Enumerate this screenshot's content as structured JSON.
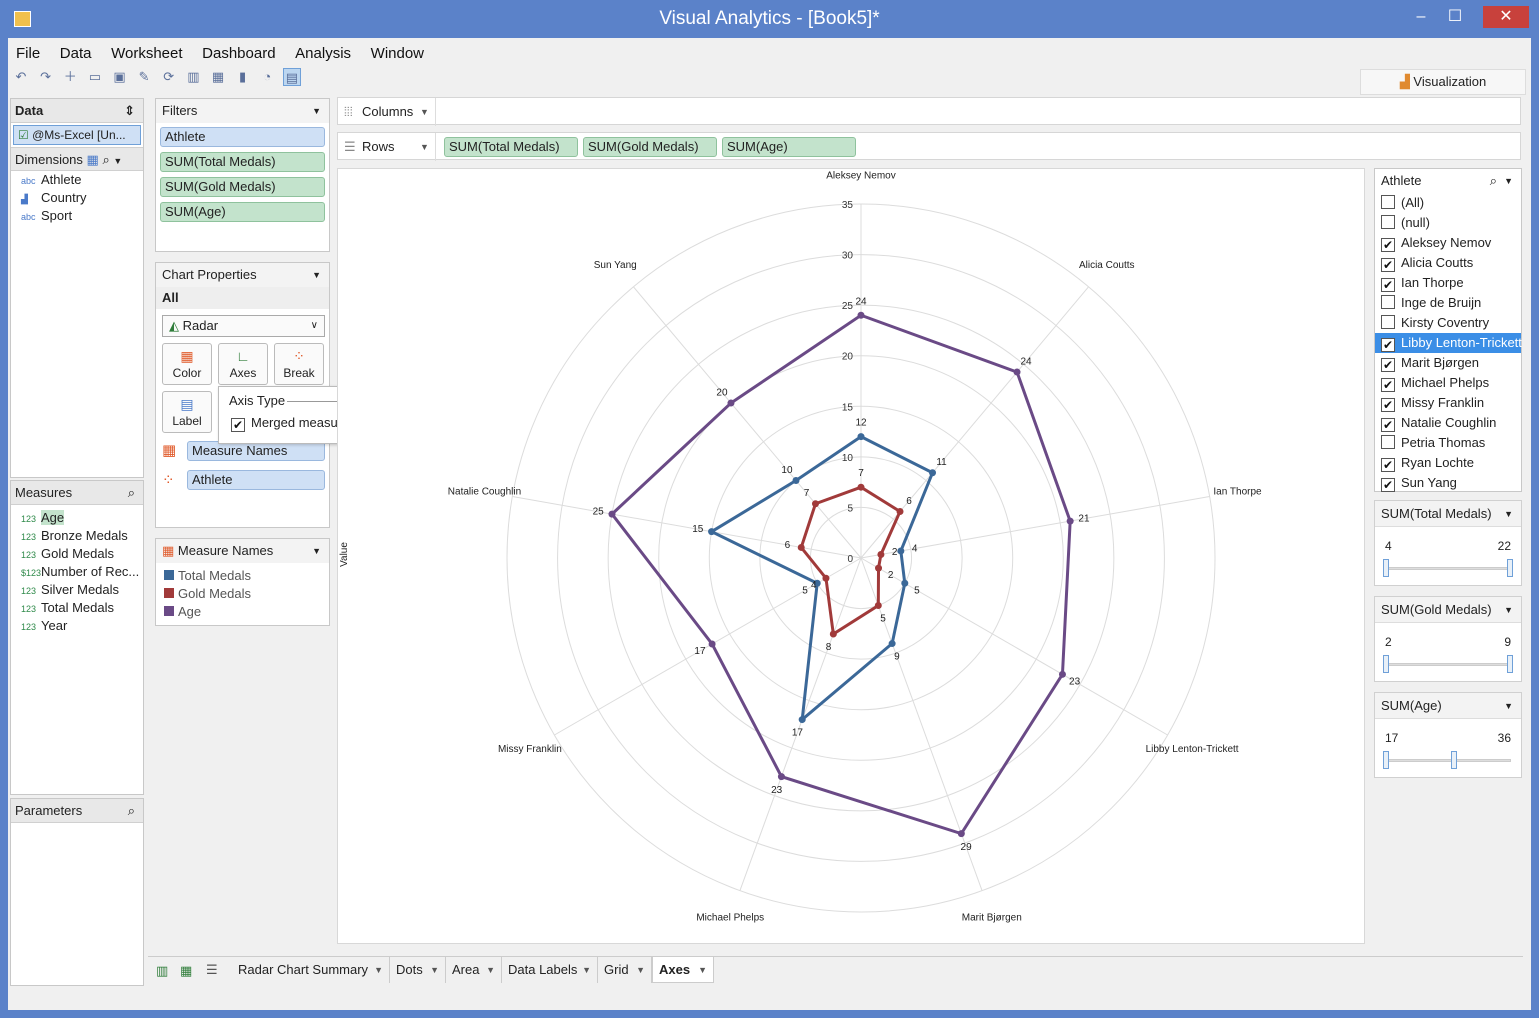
{
  "window": {
    "title": "Visual Analytics - [Book5]*"
  },
  "menu": [
    "File",
    "Data",
    "Worksheet",
    "Dashboard",
    "Analysis",
    "Window"
  ],
  "toolbar": {
    "visualization_label": "Visualization"
  },
  "data_panel": {
    "title": "Data",
    "source": "@Ms-Excel [Un...",
    "dimensions_title": "Dimensions",
    "dimensions": [
      {
        "type": "abc",
        "name": "Athlete"
      },
      {
        "type": "geo",
        "name": "Country"
      },
      {
        "type": "abc",
        "name": "Sport"
      }
    ],
    "measures_title": "Measures",
    "measures": [
      {
        "type": "123",
        "name": "Age"
      },
      {
        "type": "123",
        "name": "Bronze Medals"
      },
      {
        "type": "123",
        "name": "Gold Medals"
      },
      {
        "type": "$123",
        "name": "Number of Rec..."
      },
      {
        "type": "123",
        "name": "Silver Medals"
      },
      {
        "type": "123",
        "name": "Total Medals"
      },
      {
        "type": "123",
        "name": "Year"
      }
    ],
    "parameters_title": "Parameters"
  },
  "filters": {
    "title": "Filters",
    "items": [
      {
        "label": "Athlete",
        "kind": "dimension"
      },
      {
        "label": "SUM(Total Medals)",
        "kind": "measure"
      },
      {
        "label": "SUM(Gold Medals)",
        "kind": "measure"
      },
      {
        "label": "SUM(Age)",
        "kind": "measure"
      }
    ]
  },
  "chart_properties": {
    "title": "Chart Properties",
    "scope": "All",
    "chart_type": "Radar",
    "buttons": [
      "Color",
      "Axes",
      "Break",
      "Label"
    ],
    "popup": {
      "title": "Axis Type",
      "option": "Merged measure",
      "checked": true
    },
    "fields": [
      "Measure Names",
      "Athlete"
    ]
  },
  "legend": {
    "title": "Measure Names",
    "items": [
      {
        "label": "Total Medals",
        "color": "#3b6898"
      },
      {
        "label": "Gold Medals",
        "color": "#a13a3a"
      },
      {
        "label": "Age",
        "color": "#6a4a86"
      }
    ]
  },
  "shelves": {
    "columns_label": "Columns",
    "rows_label": "Rows",
    "rows_pills": [
      "SUM(Total Medals)",
      "SUM(Gold Medals)",
      "SUM(Age)"
    ]
  },
  "athlete_filter": {
    "title": "Athlete",
    "items": [
      {
        "label": "(All)",
        "checked": false,
        "selected": false
      },
      {
        "label": "(null)",
        "checked": false,
        "selected": false
      },
      {
        "label": "Aleksey Nemov",
        "checked": true,
        "selected": false
      },
      {
        "label": "Alicia Coutts",
        "checked": true,
        "selected": false
      },
      {
        "label": "Ian Thorpe",
        "checked": true,
        "selected": false
      },
      {
        "label": "Inge de Bruijn",
        "checked": false,
        "selected": false
      },
      {
        "label": "Kirsty Coventry",
        "checked": false,
        "selected": false
      },
      {
        "label": "Libby Lenton-Trickett",
        "checked": true,
        "selected": true
      },
      {
        "label": "Marit Bjørgen",
        "checked": true,
        "selected": false
      },
      {
        "label": "Michael Phelps",
        "checked": true,
        "selected": false
      },
      {
        "label": "Missy Franklin",
        "checked": true,
        "selected": false
      },
      {
        "label": "Natalie Coughlin",
        "checked": true,
        "selected": false
      },
      {
        "label": "Petria Thomas",
        "checked": false,
        "selected": false
      },
      {
        "label": "Ryan Lochte",
        "checked": true,
        "selected": false
      },
      {
        "label": "Sun Yang",
        "checked": true,
        "selected": false
      }
    ]
  },
  "range_filters": [
    {
      "title": "SUM(Total Medals)",
      "min": "4",
      "max": "22",
      "low": 0,
      "high": 1
    },
    {
      "title": "SUM(Gold Medals)",
      "min": "2",
      "max": "9",
      "low": 0,
      "high": 1
    },
    {
      "title": "SUM(Age)",
      "min": "17",
      "max": "36",
      "low": 0,
      "high": 0.55
    }
  ],
  "tabs": [
    {
      "label": "Radar Chart Summary",
      "active": false
    },
    {
      "label": "Dots",
      "active": false
    },
    {
      "label": "Area",
      "active": false
    },
    {
      "label": "Data Labels",
      "active": false
    },
    {
      "label": "Grid",
      "active": false
    },
    {
      "label": "Axes",
      "active": true
    }
  ],
  "chart_data": {
    "type": "radar",
    "ylabel": "Value",
    "ylim": [
      0,
      35
    ],
    "ticks": [
      0,
      5,
      10,
      15,
      20,
      25,
      30,
      35
    ],
    "categories": [
      "Aleksey Nemov",
      "Alicia Coutts",
      "Ian Thorpe",
      "Libby Lenton-Trickett",
      "Marit Bjørgen",
      "Michael Phelps",
      "Missy Franklin",
      "Natalie Coughlin",
      "Sun Yang"
    ],
    "series": [
      {
        "name": "Total Medals",
        "color": "#3b6898",
        "values": [
          12,
          11,
          4,
          5,
          9,
          17,
          5,
          15,
          10
        ]
      },
      {
        "name": "Gold Medals",
        "color": "#a13a3a",
        "values": [
          7,
          6,
          2,
          2,
          5,
          8,
          4,
          6,
          7
        ]
      },
      {
        "name": "Age",
        "color": "#6a4a86",
        "values": [
          24,
          24,
          21,
          23,
          29,
          23,
          17,
          25,
          20
        ]
      }
    ]
  }
}
